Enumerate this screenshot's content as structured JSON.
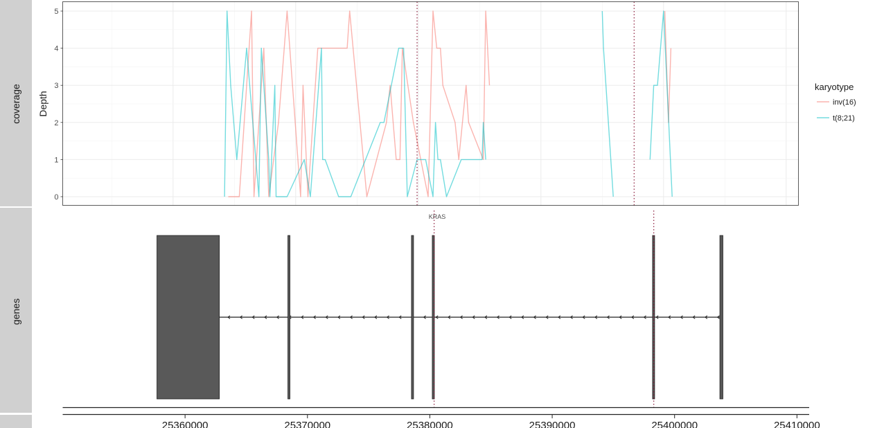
{
  "chart_data": {
    "type": "line",
    "panels": [
      "coverage",
      "genes"
    ],
    "ylabel": "Depth",
    "ylim": [
      0,
      5
    ],
    "yticks": [
      "0",
      "1",
      "2",
      "3",
      "4",
      "5"
    ],
    "xlim": [
      25351000,
      25411000
    ],
    "xticks": [
      25360000,
      25370000,
      25380000,
      25390000,
      25400000,
      25410000
    ],
    "xtick_labels": [
      "25360000",
      "25370000",
      "25380000",
      "25390000",
      "25400000",
      "25410000"
    ],
    "grid": true,
    "legend": {
      "title": "karyotype",
      "position": "right"
    },
    "markers": [
      25379900,
      25397600
    ],
    "series": [
      {
        "name": "inv(16)",
        "color": "#F8766D",
        "points": [
          [
            25364500,
            0
          ],
          [
            25365400,
            0
          ],
          [
            25366400,
            5
          ],
          [
            25366600,
            0
          ],
          [
            25367400,
            4
          ],
          [
            25367800,
            0
          ],
          [
            25368600,
            2
          ],
          [
            25369300,
            5
          ],
          [
            25370400,
            0
          ],
          [
            25370600,
            3
          ],
          [
            25371000,
            0
          ],
          [
            25371800,
            4
          ],
          [
            25373000,
            4
          ],
          [
            25374200,
            4
          ],
          [
            25374400,
            5
          ],
          [
            25375800,
            0
          ],
          [
            25377400,
            2
          ],
          [
            25377700,
            3
          ],
          [
            25378200,
            1
          ],
          [
            25378500,
            1
          ],
          [
            25378700,
            4
          ],
          [
            25379600,
            2
          ],
          [
            25380800,
            0
          ],
          [
            25381200,
            5
          ],
          [
            25381500,
            4
          ],
          [
            25381800,
            4
          ],
          [
            25382000,
            3
          ],
          [
            25383000,
            2
          ],
          [
            25383300,
            1
          ],
          [
            25383900,
            3
          ],
          [
            25384100,
            2
          ],
          [
            25385300,
            1
          ],
          [
            25385500,
            5
          ],
          [
            25385800,
            3
          ]
        ],
        "points2": [
          [
            25400600,
            4
          ],
          [
            25400400,
            2
          ],
          [
            25400100,
            5
          ]
        ]
      },
      {
        "name": "t(8;21)",
        "color": "#00BFC4",
        "points": [
          [
            25364200,
            0
          ],
          [
            25364400,
            5
          ],
          [
            25364700,
            3
          ],
          [
            25365200,
            1
          ],
          [
            25366000,
            4
          ],
          [
            25367000,
            0
          ],
          [
            25367200,
            4
          ],
          [
            25367800,
            1
          ],
          [
            25367900,
            0
          ],
          [
            25368300,
            3
          ],
          [
            25368400,
            0
          ],
          [
            25369300,
            0
          ],
          [
            25370700,
            1
          ],
          [
            25371200,
            0
          ],
          [
            25372100,
            4
          ],
          [
            25372200,
            1
          ],
          [
            25372400,
            1
          ],
          [
            25373500,
            0
          ],
          [
            25374500,
            0
          ],
          [
            25376900,
            2
          ],
          [
            25377200,
            2
          ],
          [
            25378400,
            4
          ],
          [
            25378800,
            4
          ],
          [
            25379100,
            0
          ],
          [
            25379900,
            1
          ],
          [
            25380600,
            1
          ],
          [
            25381200,
            0
          ],
          [
            25381400,
            2
          ],
          [
            25381600,
            1
          ],
          [
            25381800,
            1
          ],
          [
            25382300,
            0
          ],
          [
            25383500,
            1
          ],
          [
            25384300,
            1
          ],
          [
            25385200,
            1
          ],
          [
            25385300,
            2
          ],
          [
            25385500,
            1
          ]
        ],
        "points2": [
          [
            25395000,
            5
          ],
          [
            25395100,
            4
          ],
          [
            25395900,
            0
          ]
        ],
        "points3": [
          [
            25398900,
            1
          ],
          [
            25399200,
            3
          ],
          [
            25399500,
            3
          ],
          [
            25400000,
            5
          ],
          [
            25400700,
            0
          ]
        ]
      }
    ],
    "gene": {
      "name": "KRAS",
      "start": 25362800,
      "end": 25403800,
      "strand": "-",
      "exons": [
        [
          25357700,
          25362800
        ],
        [
          25368400,
          25368500
        ],
        [
          25378500,
          25378600
        ],
        [
          25380200,
          25380350
        ],
        [
          25398200,
          25398300
        ],
        [
          25403700,
          25403950
        ]
      ]
    }
  }
}
